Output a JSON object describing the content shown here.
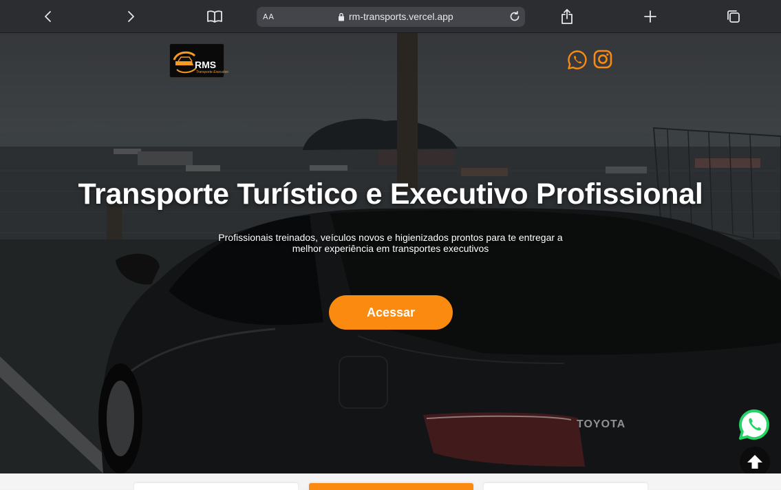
{
  "browser": {
    "url": "rm-transports.vercel.app",
    "reader_label": "AA",
    "icons": [
      "back-icon",
      "forward-icon",
      "bookmarks-icon",
      "lock-icon",
      "reload-icon",
      "share-icon",
      "new-tab-icon",
      "tabs-icon"
    ]
  },
  "header": {
    "logo_text": "RMS",
    "logo_subtitle": "Transporte Executivo",
    "social_icons": [
      "whatsapp-icon",
      "instagram-icon"
    ]
  },
  "hero": {
    "title": "Transporte Turístico e Executivo Profissional",
    "subtitle": "Profissionais treinados, veículos novos e higienizados prontos para te entregar a melhor experiência em transportes executivos",
    "cta_label": "Acessar",
    "car_brand_text": "TOYOTA"
  },
  "colors": {
    "accent": "#fb8a11",
    "whatsapp": "#25d366",
    "text": "#ffffff"
  }
}
